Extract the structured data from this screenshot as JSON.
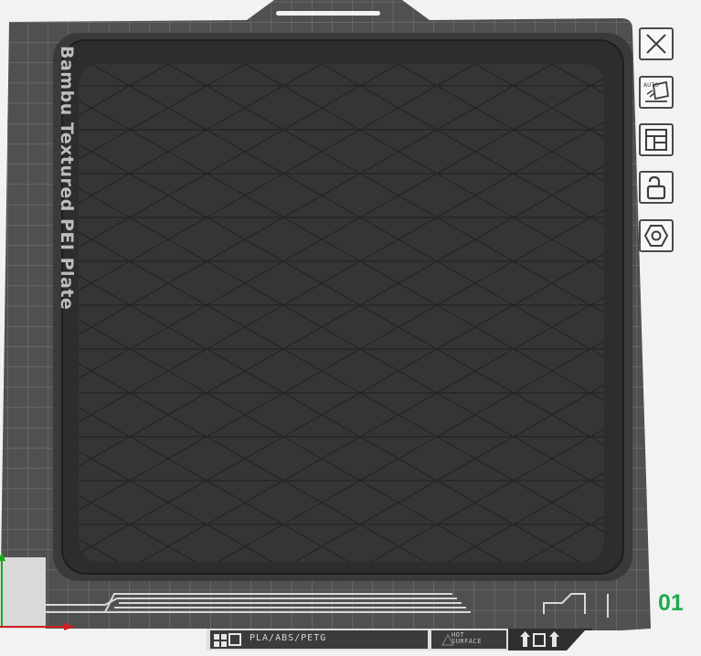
{
  "plate": {
    "name": "Bambu Textured PEI Plate",
    "number": "01",
    "filament_types": "PLA/ABS/PETG",
    "hot_surface_line1": "HOT",
    "hot_surface_line2": "SURFACE"
  },
  "toolbar": {
    "items": [
      {
        "icon": "close-icon"
      },
      {
        "icon": "auto-orient-icon",
        "badge": "AUTO"
      },
      {
        "icon": "arrange-icon"
      },
      {
        "icon": "unlock-icon"
      },
      {
        "icon": "plate-settings-icon"
      }
    ]
  },
  "colors": {
    "plate_bg": "#4f4f4f",
    "grid_line": "#7a7a7a",
    "tray": "#353535",
    "tray_floor": "#2f2f2f",
    "plate_number": "#1faa4f",
    "axis_x": "#d01f1f",
    "axis_y": "#1ba81b"
  }
}
